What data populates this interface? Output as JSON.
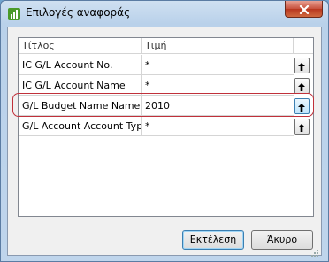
{
  "window": {
    "title": "Επιλογές αναφοράς"
  },
  "grid": {
    "columns": [
      "Τίτλος",
      "Τιμή"
    ],
    "rows": [
      {
        "name": "IC G/L Account No.",
        "value": "*"
      },
      {
        "name": "IC G/L Account Name",
        "value": "*"
      },
      {
        "name": "G/L Budget Name Name",
        "value": "2010",
        "selected": true
      },
      {
        "name": "G/L Account Account Type",
        "value": "*"
      }
    ]
  },
  "buttons": {
    "ok_label": "Εκτέλεση",
    "cancel_label": "Άκυρο"
  },
  "colors": {
    "highlight": "#c0303a",
    "close": "#c7503b"
  },
  "icons": {
    "app": "report-icon",
    "close": "close-icon",
    "row_button": "arrow-up-icon"
  }
}
